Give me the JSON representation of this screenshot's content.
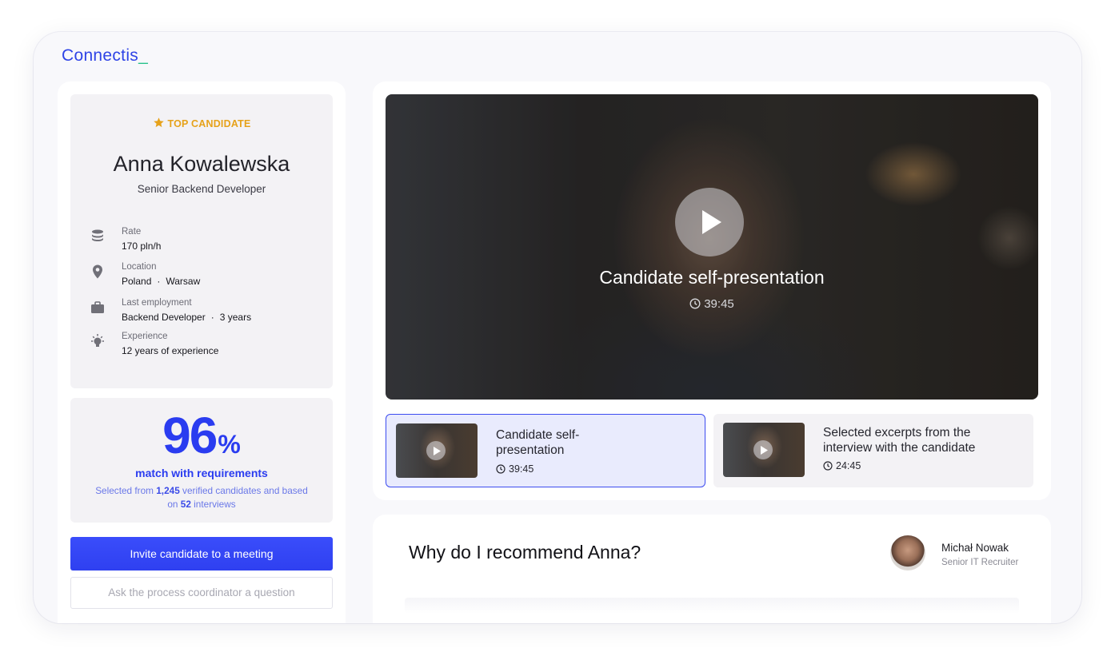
{
  "brand": {
    "name": "Connectis",
    "cursor": "_"
  },
  "candidate": {
    "badge": "TOP CANDIDATE",
    "name": "Anna Kowalewska",
    "role": "Senior Backend Developer",
    "details": [
      {
        "icon": "coins-icon",
        "label": "Rate",
        "value": "170 pln/h"
      },
      {
        "icon": "location-pin-icon",
        "label": "Location",
        "value_parts": [
          "Poland",
          "Warsaw"
        ]
      },
      {
        "icon": "briefcase-icon",
        "label": "Last employment",
        "value_parts": [
          "Backend Developer",
          "3 years"
        ]
      },
      {
        "icon": "lightbulb-icon",
        "label": "Experience",
        "value": "12 years of experience"
      }
    ]
  },
  "match": {
    "percent": "96",
    "percent_sign": "%",
    "label": "match with requirements",
    "desc_prefix": "Selected from ",
    "candidates_count": "1,245",
    "desc_middle": " verified candidates and based on ",
    "interviews_count": "52",
    "desc_suffix": " interviews"
  },
  "actions": {
    "invite": "Invite candidate to a meeting",
    "ask": "Ask the process coordinator a question"
  },
  "player": {
    "title": "Candidate self-presentation",
    "duration": "39:45"
  },
  "videos": [
    {
      "title": "Candidate self-presentation",
      "duration": "39:45",
      "active": true
    },
    {
      "title": "Selected excerpts from the interview with the candidate",
      "duration": "24:45",
      "active": false
    }
  ],
  "recommendation": {
    "title": "Why do I recommend Anna?",
    "recruiter_name": "Michał Nowak",
    "recruiter_role": "Senior IT Recruiter"
  },
  "colors": {
    "accent": "#2f40f0",
    "badge": "#e6a21a",
    "brand_cursor": "#27c28b"
  }
}
